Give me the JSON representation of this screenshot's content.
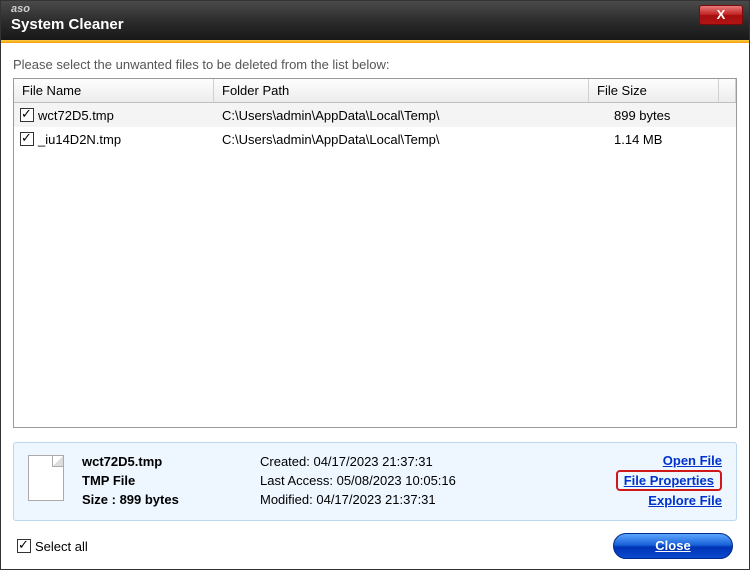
{
  "titlebar": {
    "small": "aso",
    "main": "System Cleaner",
    "close_glyph": "X"
  },
  "instruction": "Please select the unwanted files to be deleted from the list below:",
  "grid": {
    "headers": {
      "name": "File Name",
      "path": "Folder Path",
      "size": "File Size"
    },
    "rows": [
      {
        "checked": true,
        "name": "wct72D5.tmp",
        "path": "C:\\Users\\admin\\AppData\\Local\\Temp\\",
        "size": "899 bytes"
      },
      {
        "checked": true,
        "name": "_iu14D2N.tmp",
        "path": "C:\\Users\\admin\\AppData\\Local\\Temp\\",
        "size": "1.14 MB"
      }
    ]
  },
  "details": {
    "filename": "wct72D5.tmp",
    "filetype": "TMP File",
    "size_label": "Size : 899 bytes",
    "created": "Created: 04/17/2023 21:37:31",
    "last_access": "Last Access: 05/08/2023 10:05:16",
    "modified": "Modified: 04/17/2023 21:37:31",
    "links": {
      "open": "Open File",
      "properties": "File Properties",
      "explore": "Explore File"
    }
  },
  "footer": {
    "select_all": "Select all",
    "close": "Close"
  }
}
